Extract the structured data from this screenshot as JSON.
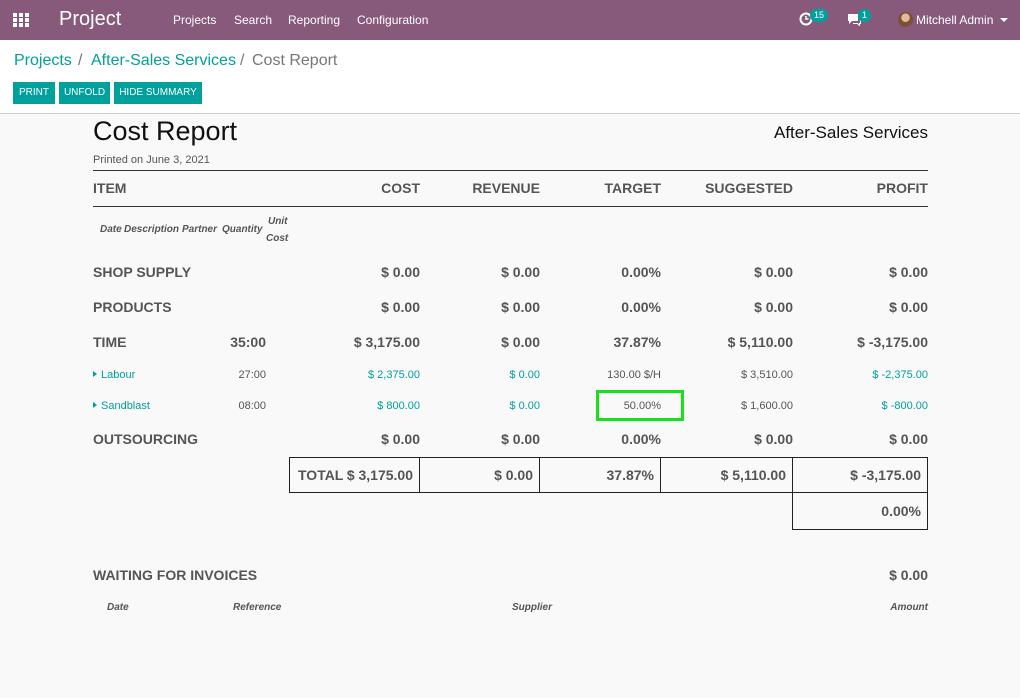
{
  "navbar": {
    "brand": "Project",
    "menu": [
      "Projects",
      "Search",
      "Reporting",
      "Configuration"
    ],
    "activity_count": "15",
    "message_count": "1",
    "user": "Mitchell Admin"
  },
  "breadcrumb": {
    "items": [
      "Projects",
      "After-Sales Services",
      "Cost Report"
    ],
    "separator": "/"
  },
  "buttons": {
    "print": "PRINT",
    "unfold": "UNFOLD",
    "hide_summary": "HIDE SUMMARY"
  },
  "report": {
    "title": "Cost Report",
    "project": "After-Sales Services",
    "printed_on": "Printed on June 3, 2021",
    "headers": [
      "ITEM",
      "COST",
      "REVENUE",
      "TARGET",
      "SUGGESTED",
      "PROFIT"
    ],
    "sub_headers": [
      "Date",
      "Description",
      "Partner",
      "Quantity",
      "Unit",
      "Cost"
    ],
    "sections": {
      "shop_supply": {
        "name": "SHOP SUPPLY",
        "cost": "$ 0.00",
        "revenue": "$ 0.00",
        "target": "0.00%",
        "suggested": "$ 0.00",
        "profit": "$ 0.00"
      },
      "products": {
        "name": "PRODUCTS",
        "cost": "$ 0.00",
        "revenue": "$ 0.00",
        "target": "0.00%",
        "suggested": "$ 0.00",
        "profit": "$ 0.00"
      },
      "time": {
        "name": "TIME",
        "hours": "35:00",
        "cost": "$ 3,175.00",
        "revenue": "$ 0.00",
        "target": "37.87%",
        "suggested": "$ 5,110.00",
        "profit": "$ -3,175.00"
      },
      "outsourcing": {
        "name": "OUTSOURCING",
        "cost": "$ 0.00",
        "revenue": "$ 0.00",
        "target": "0.00%",
        "suggested": "$ 0.00",
        "profit": "$ 0.00"
      }
    },
    "lines": {
      "labour": {
        "name": "Labour",
        "hours": "27:00",
        "cost": "$ 2,375.00",
        "revenue": "$ 0.00",
        "target": "130.00 $/H",
        "suggested": "$ 3,510.00",
        "profit": "$ -2,375.00"
      },
      "sandblast": {
        "name": "Sandblast",
        "hours": "08:00",
        "cost": "$ 800.00",
        "revenue": "$ 0.00",
        "target": "50.00%",
        "suggested": "$ 1,600.00",
        "profit": "$ -800.00"
      }
    },
    "total": {
      "label": "TOTAL",
      "cost": "$ 3,175.00",
      "revenue": "$ 0.00",
      "target": "37.87%",
      "suggested": "$ 5,110.00",
      "profit": "$ -3,175.00",
      "profit_pct": "0.00%"
    },
    "waiting": {
      "title": "WAITING FOR INVOICES",
      "amount": "$ 0.00",
      "columns": [
        "Date",
        "Reference",
        "Supplier",
        "Amount"
      ]
    }
  }
}
